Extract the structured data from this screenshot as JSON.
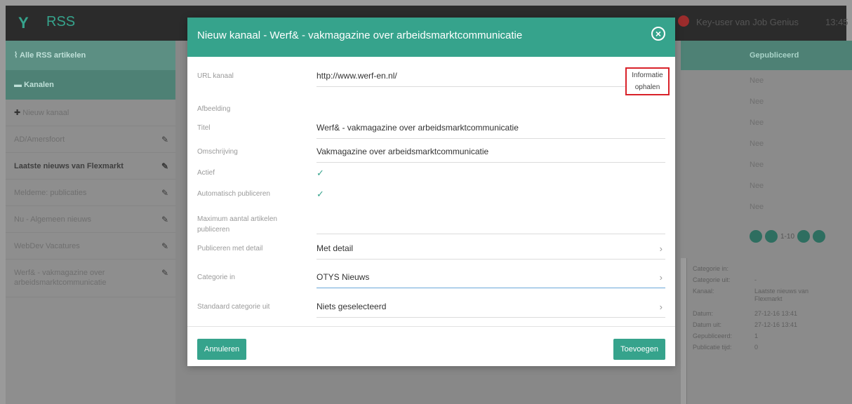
{
  "topbar": {
    "logo": "Y",
    "app_title": "RSS",
    "user": "Key-user van Job Genius",
    "clock": "13:45"
  },
  "sidebar": {
    "all_articles": "Alle RSS artikelen",
    "channels": "Kanalen",
    "new_channel": "Nieuw kanaal",
    "items": [
      {
        "label": "AD/Amersfoort"
      },
      {
        "label": "Laatste nieuws van Flexmarkt"
      },
      {
        "label": "Meldeme: publicaties"
      },
      {
        "label": "Nu - Algemeen nieuws"
      },
      {
        "label": "WebDev Vacatures"
      },
      {
        "label": "Werf& - vakmagazine over arbeidsmarktcommunicatie"
      }
    ]
  },
  "right_column": {
    "header": "Gepubliceerd",
    "rows": [
      "Nee",
      "Nee",
      "Nee",
      "Nee",
      "Nee",
      "Nee",
      "Nee"
    ],
    "pager_text": "1-10"
  },
  "details": [
    {
      "key": "Categorie in:",
      "value": ""
    },
    {
      "key": "Categorie uit:",
      "value": "-"
    },
    {
      "key": "Kanaal:",
      "value": "Laatste nieuws van Flexmarkt"
    },
    {
      "key": "Datum:",
      "value": "27-12-16 13:41"
    },
    {
      "key": "Datum uit:",
      "value": "27-12-16 13:41"
    },
    {
      "key": "Gepubliceerd:",
      "value": "1"
    },
    {
      "key": "Publicatie tijd:",
      "value": "0"
    }
  ],
  "modal": {
    "title": "Nieuw kanaal - Werf& - vakmagazine over arbeidsmarktcommunicatie",
    "close_icon": "⊗",
    "info_button": [
      "Informatie",
      "ophalen"
    ],
    "fields": {
      "url": {
        "label": "URL kanaal",
        "value": "http://www.werf-en.nl/"
      },
      "image": {
        "label": "Afbeelding"
      },
      "title": {
        "label": "Titel",
        "value": "Werf& - vakmagazine over arbeidsmarktcommunicatie"
      },
      "description": {
        "label": "Omschrijving",
        "value": "Vakmagazine over arbeidsmarktcommunicatie"
      },
      "active": {
        "label": "Actief",
        "checked": true
      },
      "auto_publish": {
        "label": "Automatisch publiceren",
        "checked": true
      },
      "max_articles": {
        "label": [
          "Maximum aantal artikelen",
          "publiceren"
        ],
        "value": ""
      },
      "publish_detail": {
        "label": "Publiceren met detail",
        "value": "Met detail"
      },
      "category_in": {
        "label": "Categorie in",
        "value": "OTYS Nieuws"
      },
      "category_out": {
        "label": "Standaard categorie uit",
        "value": "Niets geselecteerd"
      }
    },
    "cancel_label": "Annuleren",
    "add_label": "Toevoegen"
  },
  "colors": {
    "accent": "#36a38c",
    "highlight": "#d9222a",
    "check": "#36a38c"
  }
}
